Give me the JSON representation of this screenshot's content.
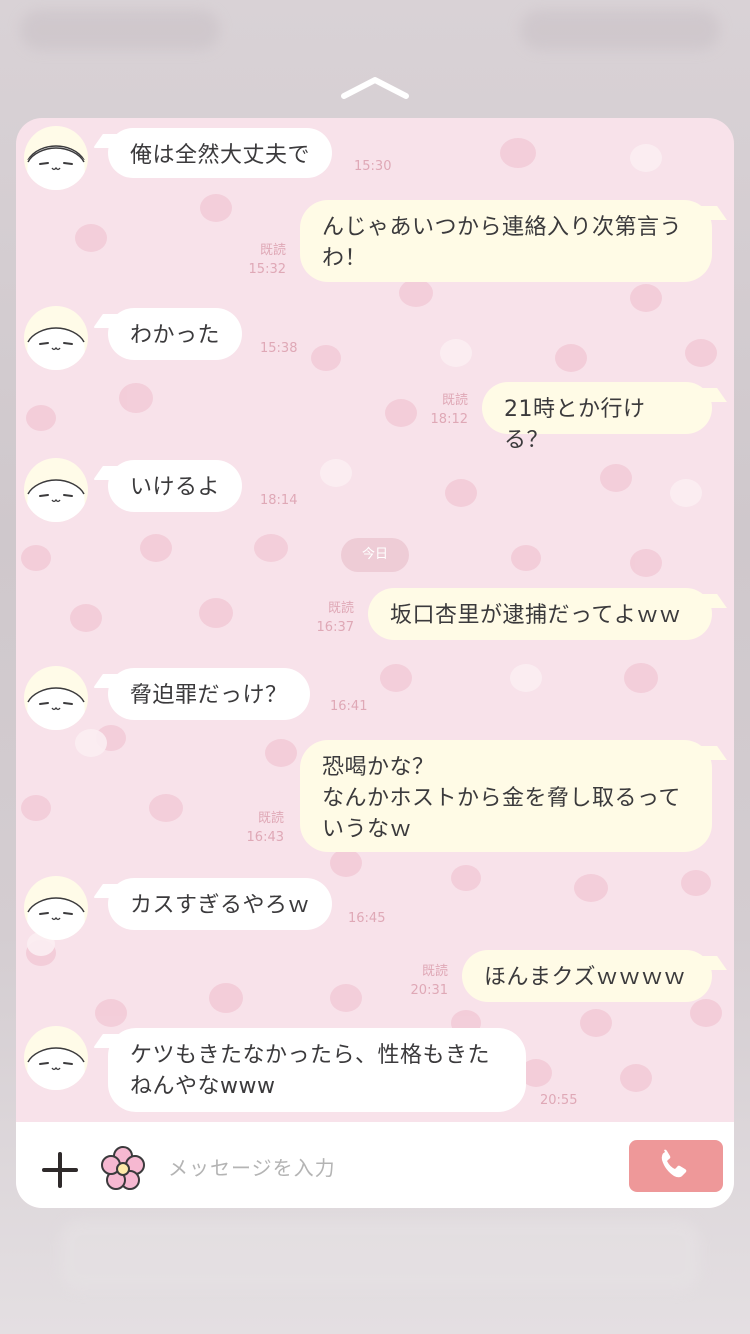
{
  "chat": {
    "messages": [
      {
        "side": "in",
        "text": "俺は全然大丈夫で",
        "time": "15:30",
        "read": ""
      },
      {
        "side": "out",
        "text": "んじゃあいつから連絡入り次第言うわ！",
        "time": "15:32",
        "read": "既読"
      },
      {
        "side": "in",
        "text": "わかった",
        "time": "15:38",
        "read": ""
      },
      {
        "side": "out",
        "text": "21時とか行ける？",
        "time": "18:12",
        "read": "既読"
      },
      {
        "side": "in",
        "text": "いけるよ",
        "time": "18:14",
        "read": ""
      },
      {
        "side": "out",
        "text": "坂口杏里が逮捕だってよｗｗ",
        "time": "16:37",
        "read": "既読"
      },
      {
        "side": "in",
        "text": "脅迫罪だっけ？",
        "time": "16:41",
        "read": ""
      },
      {
        "side": "out",
        "text": "恐喝かな？\nなんかホストから金を脅し取るっていうなｗ",
        "time": "16:43",
        "read": "既読"
      },
      {
        "side": "in",
        "text": "カスすぎるやろｗ",
        "time": "16:45",
        "read": ""
      },
      {
        "side": "out",
        "text": "ほんまクズｗｗｗｗ",
        "time": "20:31",
        "read": "既読"
      },
      {
        "side": "in",
        "text": "ケツもきたなかったら、性格もきたねんやなwww",
        "time": "20:55",
        "read": ""
      }
    ],
    "date_separator": "今日"
  },
  "input": {
    "placeholder": "メッセージを入力"
  },
  "icons": {
    "expand": "chevron-up-icon",
    "attach": "plus-icon",
    "sticker": "flower-icon",
    "call": "phone-icon"
  },
  "colors": {
    "panel_bg": "#f8e2ea",
    "incoming_bubble": "#ffffff",
    "outgoing_bubble": "#fffbe6",
    "meta_text": "#dfa8b6",
    "call_button": "#ee9899"
  }
}
